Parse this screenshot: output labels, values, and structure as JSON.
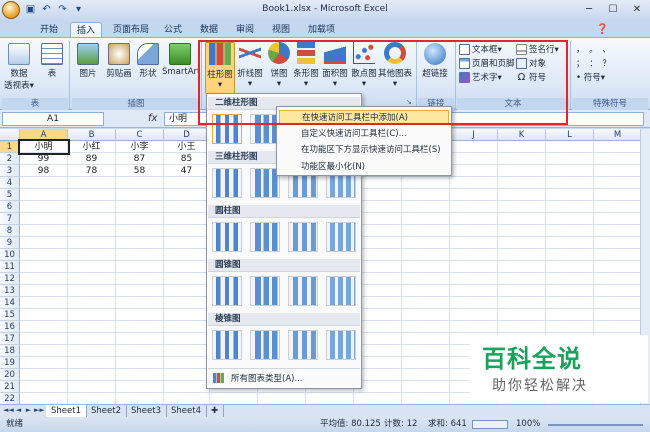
{
  "window": {
    "title": "Book1.xlsx - Microsoft Excel",
    "minimize": "─",
    "maximize": "☐",
    "close": "✕"
  },
  "qat": {
    "save_icon": "save-icon",
    "undo": "↶",
    "redo": "↷",
    "customize": "▾"
  },
  "tabs": [
    "开始",
    "插入",
    "页面布局",
    "公式",
    "数据",
    "审阅",
    "视图",
    "加载项"
  ],
  "active_tab": "插入",
  "ribbon": {
    "tables_group": {
      "label": "表",
      "pivot": "数据\n透视表",
      "pivot_line1": "数据",
      "pivot_line2": "透视表▾",
      "table": "表"
    },
    "illustrations_group": {
      "label": "插图",
      "picture": "图片",
      "clipart": "剪贴画",
      "shapes": "形状",
      "smartart": "SmartArt"
    },
    "charts_group": {
      "column": "柱形图",
      "line": "折线图",
      "pie": "饼图",
      "bar": "条形图",
      "area": "面积图",
      "scatter": "散点图",
      "other": "其他图表"
    },
    "links_group": {
      "label": "链接",
      "hyperlink": "超链接"
    },
    "text_group": {
      "label": "文本",
      "textbox": "文本框▾",
      "header_footer": "页眉和页脚",
      "wordart": "艺术字▾",
      "signature": "签名行▾",
      "object": "对象",
      "symbol": "符号"
    },
    "special_group": {
      "label": "特殊符号",
      "symbol_menu": "符号▾",
      "row1": "，  。  、",
      "row2": "；  ：  ？"
    }
  },
  "formula_bar": {
    "name_box": "A1",
    "fx": "fx",
    "value": "小明"
  },
  "columns": [
    "A",
    "B",
    "C",
    "D",
    "E",
    "F",
    "G",
    "H",
    "I",
    "J",
    "K",
    "L",
    "M"
  ],
  "rows": [
    "1",
    "2",
    "3",
    "4",
    "5",
    "6",
    "7",
    "8",
    "9",
    "10",
    "11",
    "12",
    "13",
    "14",
    "15",
    "16",
    "17",
    "18",
    "19",
    "20",
    "21",
    "22"
  ],
  "cells": {
    "r1": [
      "小明",
      "小红",
      "小李",
      "小王"
    ],
    "r2": [
      "99",
      "89",
      "87",
      "85"
    ],
    "r3": [
      "98",
      "78",
      "58",
      "47"
    ]
  },
  "chart_dropdown": {
    "sections": [
      "二维柱形图",
      "三维柱形图",
      "圆柱图",
      "圆锥图",
      "棱锥图"
    ],
    "footer": "所有图表类型(A)..."
  },
  "context_menu": {
    "items": [
      "在快速访问工具栏中添加(A)",
      "自定义快速访问工具栏(C)...",
      "在功能区下方显示快速访问工具栏(S)",
      "功能区最小化(N)"
    ]
  },
  "sheets": [
    "Sheet1",
    "Sheet2",
    "Sheet3",
    "Sheet4"
  ],
  "status": {
    "mode": "就绪",
    "average": "平均值: 80.125",
    "count": "计数: 12",
    "sum": "求和: 641",
    "zoom": "100%"
  },
  "watermark": {
    "line1": "百科全说",
    "line2": "助你轻松解决"
  },
  "colors": {
    "ribbon_bg": "#dbe7f6",
    "highlight_red": "#e0262f",
    "accent_orange": "#ffd47d",
    "brand_green": "#1aa15a"
  }
}
